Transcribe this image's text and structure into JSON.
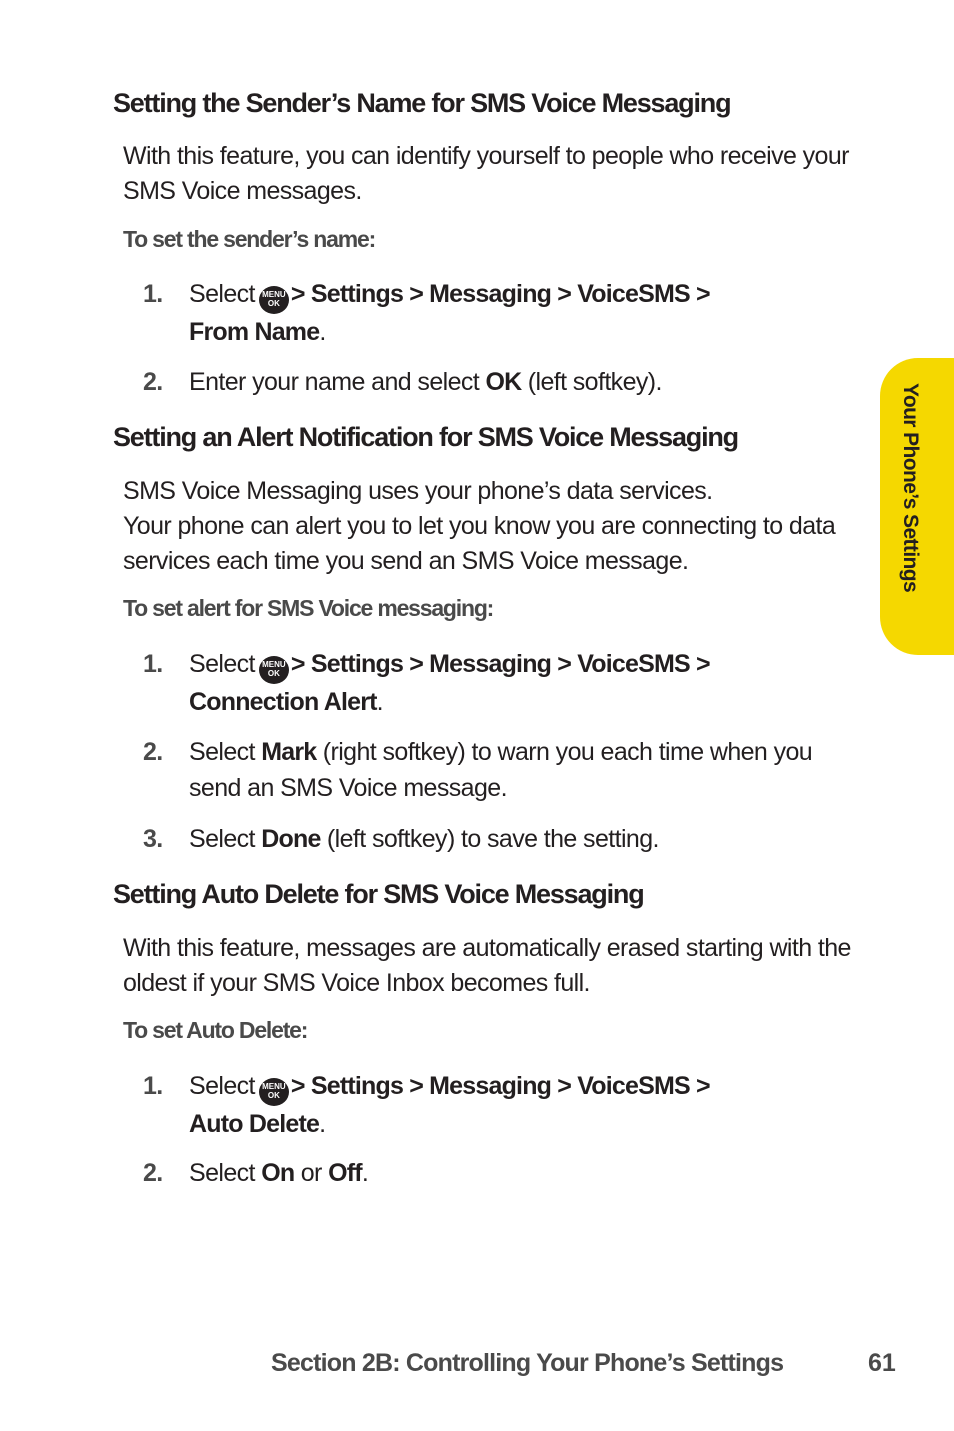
{
  "sections": [
    {
      "title": "Setting the Sender’s Name for SMS Voice Messaging",
      "intro": "With this feature, you can identify yourself to people who receive your SMS Voice messages.",
      "procedure_heading": "To set the sender’s name:",
      "steps": [
        {
          "number": "1.",
          "prefix": "Select",
          "icon": "menu-ok-key",
          "path": "> Settings > Messaging > VoiceSMS >",
          "target": "From Name",
          "suffix": "."
        },
        {
          "number": "2.",
          "prefix": "Enter your name and select",
          "bold": "OK",
          "suffix": "(left softkey)."
        }
      ]
    },
    {
      "title": "Setting an Alert Notification for SMS Voice Messaging",
      "intro_lines": [
        "SMS Voice Messaging uses your phone’s data services.",
        "Your phone can alert you to let you know you are connecting to data services each time you send an SMS Voice message."
      ],
      "procedure_heading": "To set alert for SMS Voice messaging:",
      "steps": [
        {
          "number": "1.",
          "prefix": "Select",
          "icon": "menu-ok-key",
          "path": "> Settings > Messaging > VoiceSMS >",
          "target": "Connection Alert",
          "suffix": "."
        },
        {
          "number": "2.",
          "prefix": "Select",
          "bold": "Mark",
          "suffix": "(right softkey) to warn you each time when you send an SMS Voice message."
        },
        {
          "number": "3.",
          "prefix": "Select",
          "bold": "Done",
          "suffix": "(left softkey) to save the setting."
        }
      ]
    },
    {
      "title": "Setting Auto Delete for SMS Voice Messaging",
      "intro": "With this feature, messages are automatically erased starting with the oldest if your SMS Voice Inbox becomes full.",
      "procedure_heading": "To set Auto Delete:",
      "steps": [
        {
          "number": "1.",
          "prefix": "Select",
          "icon": "menu-ok-key",
          "path": "> Settings > Messaging > VoiceSMS >",
          "target": "Auto Delete",
          "suffix": "."
        },
        {
          "number": "2.",
          "prefix": "Select",
          "bold": "On",
          "middle": "or",
          "bold2": "Off",
          "suffix": "."
        }
      ]
    }
  ],
  "menu_key": {
    "top": "MENU",
    "bottom": "OK"
  },
  "side_tab": {
    "label": "Your Phone’s Settings",
    "color": "#f5d800"
  },
  "footer": {
    "section": "Section 2B: Controlling Your Phone’s Settings",
    "page_number": "61"
  }
}
